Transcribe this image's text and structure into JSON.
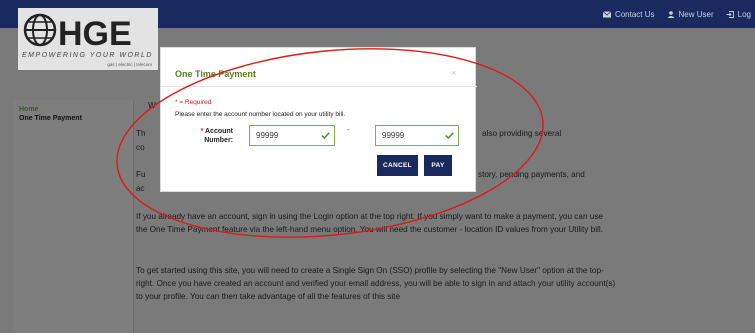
{
  "colors": {
    "nav_bg": "#1a2a5e",
    "accent_green": "#5f7d1e",
    "required_red": "#d22222",
    "button_bg": "#1a2a5e",
    "annotation": "#e01818"
  },
  "topnav": {
    "contact": {
      "label": "Contact Us",
      "icon": "envelope-icon"
    },
    "new_user": {
      "label": "New User",
      "icon": "user-icon"
    },
    "login": {
      "label": "Log",
      "icon": "login-icon"
    }
  },
  "logo": {
    "text": "HGE",
    "tagline": "EMPOWERING YOUR WORLD",
    "subline": "gas | electric | telecom"
  },
  "sidebar": {
    "items": [
      {
        "label": "Home"
      },
      {
        "label": "One Time Payment"
      }
    ]
  },
  "content": {
    "p1": "W",
    "p2_left": "Th",
    "p2_right": "also providing several",
    "p2_left2": "co",
    "p3_left": "Fu",
    "p3_right": "story, pending payments, and",
    "p3_left2": "ac",
    "p4": "If you already have an account, sign in using the Login option at the top right. If you simply want to make a payment, you can use the One Time Payment feature via the left-hand menu option. You will need the customer - location ID values from your Utility bill.",
    "p5": "To get started using this site, you will need to create a Single Sign On (SSO) profile by selecting the \"New User\" option at the top-right. Once you have created an account and verified your email address, you will be able to sign in and attach your utility account(s) to your profile. You can then take advantage of all the features of this site"
  },
  "modal": {
    "title": "One Time Payment",
    "close": "×",
    "required_note": "* = Required",
    "instruction": "Please enter the account number located on your utility bill.",
    "account_label_star": "*",
    "account_label": "Account Number:",
    "account_value_1": "99999",
    "account_value_2": "99999",
    "separator": "-",
    "cancel_label": "CANCEL",
    "pay_label": "PAY"
  }
}
